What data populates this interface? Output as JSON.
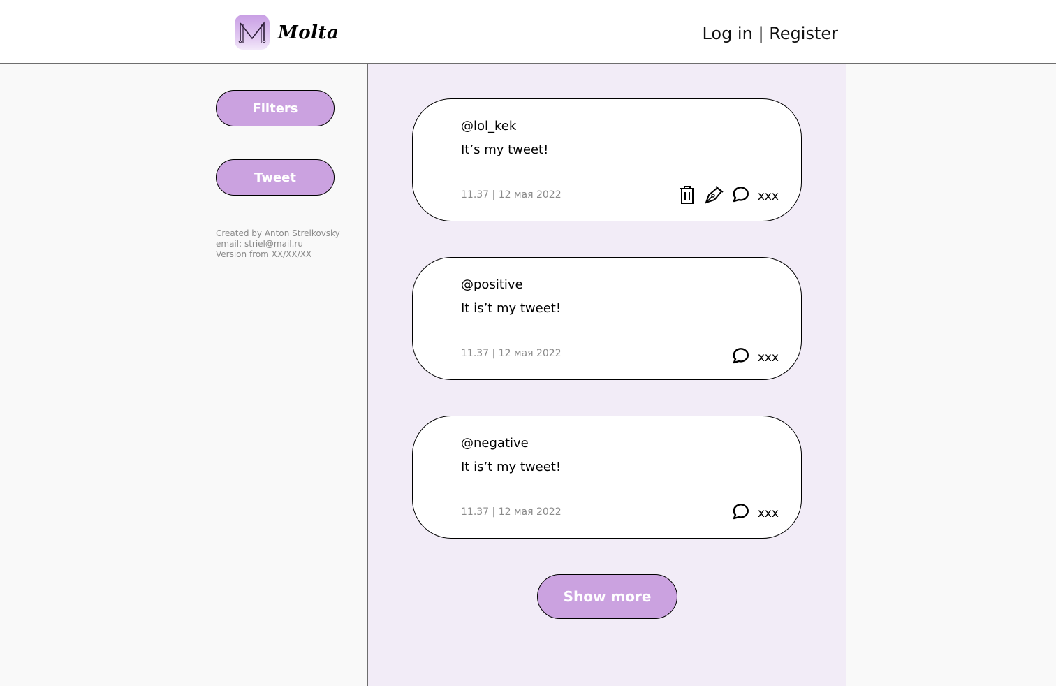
{
  "header": {
    "app_name": "Molta",
    "login_label": "Log in",
    "separator": "|",
    "register_label": "Register"
  },
  "sidebar": {
    "filters_label": "Filters",
    "tweet_label": "Tweet",
    "credits": "Created by Anton Strelkovsky",
    "email": "email: striel@mail.ru",
    "version": "Version from XX/XX/XX"
  },
  "tweets": [
    {
      "handle": "@lol_kek",
      "text": "It’s my tweet!",
      "meta": "11.37 | 12 мая 2022",
      "comments": "xxx",
      "own": true
    },
    {
      "handle": "@positive",
      "text": "It is’t my tweet!",
      "meta": "11.37 | 12 мая 2022",
      "comments": "xxx",
      "own": false
    },
    {
      "handle": "@negative",
      "text": "It is’t my tweet!",
      "meta": "11.37 | 12 мая 2022",
      "comments": "xxx",
      "own": false
    }
  ],
  "feed": {
    "show_more_label": "Show more"
  },
  "colors": {
    "accent": "#cba2e0",
    "feed_bg": "#f2ecf7",
    "page_bg": "#f9f9f9"
  },
  "icons": [
    "logo-icon",
    "trash-icon",
    "edit-pen-icon",
    "comment-bubble-icon"
  ]
}
